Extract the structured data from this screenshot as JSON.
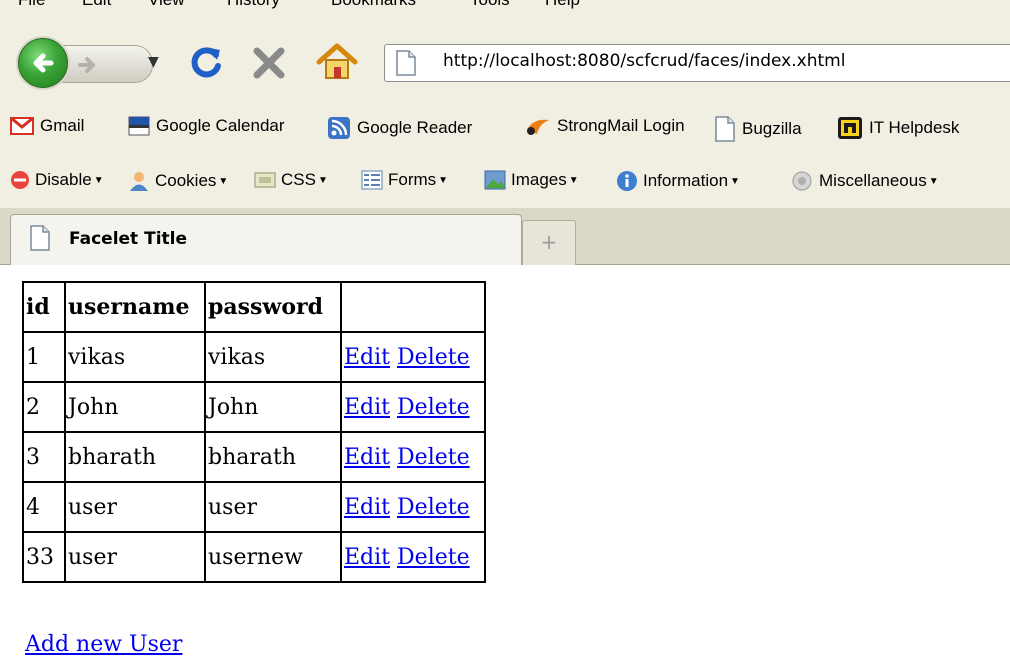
{
  "menu": {
    "items": [
      "File",
      "Edit",
      "View",
      "History",
      "Bookmarks",
      "Tools",
      "Help"
    ]
  },
  "navigation": {
    "url": "http://localhost:8080/scfcrud/faces/index.xhtml"
  },
  "bookmarks": [
    "Gmail",
    "Google Calendar",
    "Google Reader",
    "StrongMail Login",
    "Bugzilla",
    "IT Helpdesk"
  ],
  "devtools": [
    "Disable",
    "Cookies",
    "CSS",
    "Forms",
    "Images",
    "Information",
    "Miscellaneous"
  ],
  "tab": {
    "title": "Facelet Title",
    "newtab": "+"
  },
  "table": {
    "headers": [
      "id",
      "username",
      "password",
      ""
    ],
    "rows": [
      {
        "id": "1",
        "username": "vikas",
        "password": "vikas"
      },
      {
        "id": "2",
        "username": "John",
        "password": "John"
      },
      {
        "id": "3",
        "username": "bharath",
        "password": "bharath"
      },
      {
        "id": "4",
        "username": "user",
        "password": "user"
      },
      {
        "id": "33",
        "username": "user",
        "password": "usernew"
      }
    ],
    "edit_label": "Edit",
    "delete_label": "Delete"
  },
  "add_link": "Add new User",
  "colors": {
    "link": "#0000ee",
    "chrome": "#f1efe2",
    "back_button": "#3aa336",
    "reload": "#1e5fc8",
    "stop": "#8a8a8a",
    "gmail": "#d93025"
  }
}
